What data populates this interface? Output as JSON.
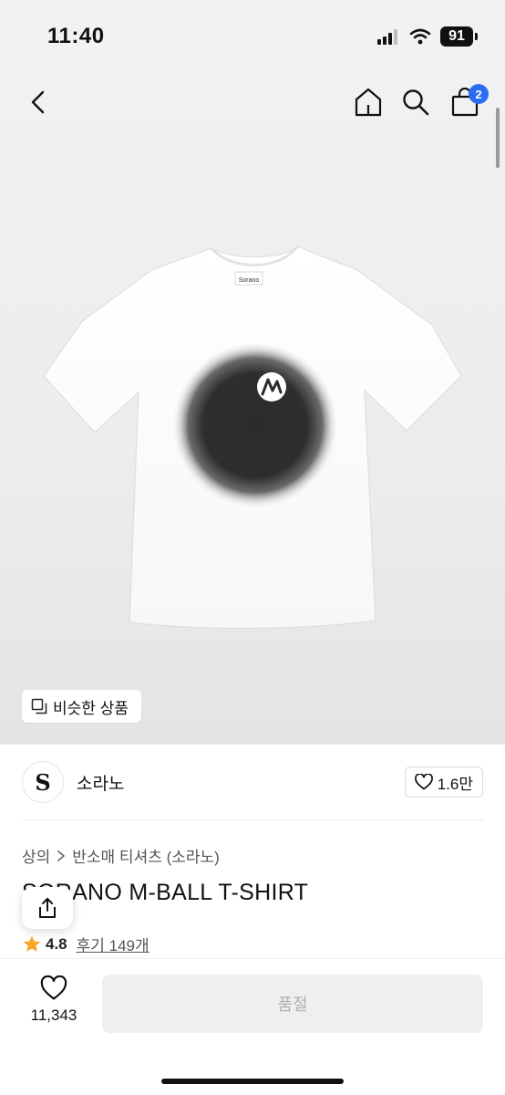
{
  "status_bar": {
    "time": "11:40",
    "battery": "91"
  },
  "nav": {
    "cart_count": "2"
  },
  "hero": {
    "similar_label": "비슷한 상품",
    "shirt_tag_text": "Sorano"
  },
  "brand": {
    "logo_letter": "S",
    "name": "소라노",
    "likes": "1.6만"
  },
  "breadcrumb": {
    "category": "상의",
    "subcategory": "반소매 티셔츠 (소라노)"
  },
  "product": {
    "title": "SORANO M-BALL T-SHIRT",
    "rating": "4.8",
    "reviews_label": "후기 149개"
  },
  "bottom": {
    "wish_count": "11,343",
    "soldout_label": "품절"
  },
  "colors": {
    "accent": "#2a6df4",
    "star": "#f5a623"
  }
}
